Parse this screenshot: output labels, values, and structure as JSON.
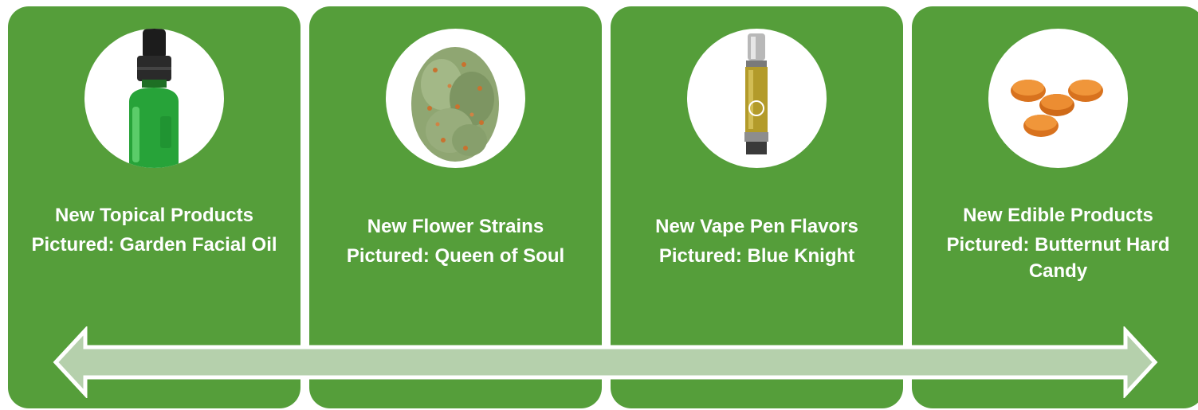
{
  "cards": [
    {
      "title": "New Topical Products",
      "pictured": "Pictured: Garden Facial Oil",
      "icon": "dropper-bottle-icon"
    },
    {
      "title": "New Flower Strains",
      "pictured": "Pictured: Queen of Soul",
      "icon": "cannabis-bud-icon"
    },
    {
      "title": "New Vape Pen Flavors",
      "pictured": "Pictured: Blue Knight",
      "icon": "vape-cartridge-icon"
    },
    {
      "title": "New Edible Products",
      "pictured": "Pictured: Butternut Hard Candy",
      "icon": "hard-candy-icon"
    }
  ],
  "colors": {
    "card_green": "#559e3a",
    "arrow_fill": "#b5d0ac",
    "text": "#ffffff"
  }
}
